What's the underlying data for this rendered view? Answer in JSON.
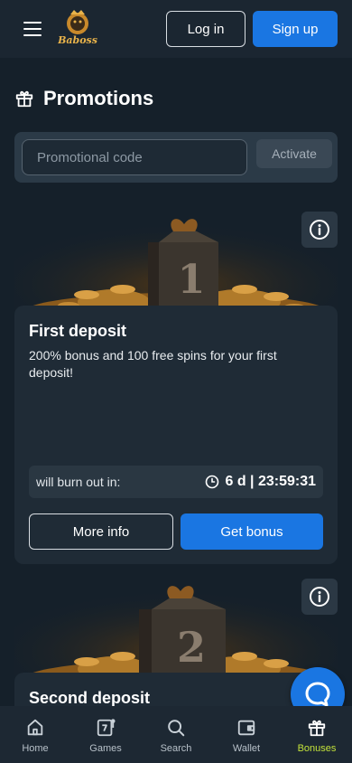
{
  "header": {
    "login_label": "Log in",
    "signup_label": "Sign up",
    "logo_text": "Baboss"
  },
  "page": {
    "title": "Promotions"
  },
  "promo": {
    "placeholder": "Promotional code",
    "activate_label": "Activate"
  },
  "cards": [
    {
      "title": "First deposit",
      "description": "200% bonus and 100 free spins for your first deposit!",
      "burn_label": "will burn out in:",
      "timer": "6 d | 23:59:31",
      "more_label": "More info",
      "get_label": "Get bonus",
      "banner_number": "1"
    },
    {
      "title": "Second deposit",
      "banner_number": "2"
    }
  ],
  "nav": {
    "items": [
      {
        "label": "Home",
        "icon": "home-icon"
      },
      {
        "label": "Games",
        "icon": "slot-icon"
      },
      {
        "label": "Search",
        "icon": "search-icon"
      },
      {
        "label": "Wallet",
        "icon": "wallet-icon"
      },
      {
        "label": "Bonuses",
        "icon": "gift-icon"
      }
    ],
    "active": "Bonuses"
  },
  "colors": {
    "accent": "#1a76e2",
    "active_nav": "#c3e23a",
    "background": "#15202a"
  }
}
